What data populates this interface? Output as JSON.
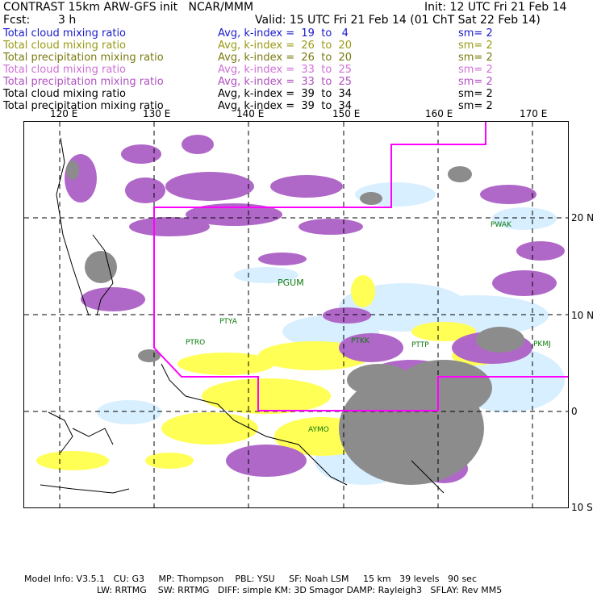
{
  "header": {
    "title": "CONTRAST 15km ARW-GFS init   NCAR/MMM",
    "init": "Init: 12 UTC Fri 21 Feb 14",
    "fcst_label": "Fcst:",
    "fcst_value": "3 h",
    "valid": "Valid: 15 UTC Fri 21 Feb 14 (01 ChT Sat 22 Feb 14)"
  },
  "legend_rows": [
    {
      "field": "Total cloud mixing ratio",
      "avg": "Avg, k-index =  19  to   4",
      "sm": "sm= 2",
      "color": "#1a1acd"
    },
    {
      "field": "Total cloud mixing ratio",
      "avg": "Avg, k-index =  26  to  20",
      "sm": "sm= 2",
      "color": "#9a9a14"
    },
    {
      "field": "Total precipitation mixing ratio",
      "avg": "Avg, k-index =  26  to  20",
      "sm": "sm= 2",
      "color": "#7a7a10"
    },
    {
      "field": "Total cloud mixing ratio",
      "avg": "Avg, k-index =  33  to  25",
      "sm": "sm= 2",
      "color": "#d070d8"
    },
    {
      "field": "Total precipitation mixing ratio",
      "avg": "Avg, k-index =  33  to  25",
      "sm": "sm= 2",
      "color": "#b050c0"
    },
    {
      "field": "Total cloud mixing ratio",
      "avg": "Avg, k-index =  39  to  34",
      "sm": "sm= 2",
      "color": "#000000"
    },
    {
      "field": "Total precipitation mixing ratio",
      "avg": "Avg, k-index =  39  to  34",
      "sm": "sm= 2",
      "color": "#000000"
    }
  ],
  "map": {
    "lon_labels": [
      "120 E",
      "130 E",
      "140 E",
      "150 E",
      "160 E",
      "170 E"
    ],
    "lat_labels": [
      "20 N",
      "10 N",
      "0",
      "10 S"
    ],
    "stations": [
      "PGUM",
      "PTYA",
      "PTRO",
      "PTKK",
      "PTTP",
      "PKMJ",
      "PWAK",
      "AYMO"
    ],
    "colors": {
      "cloud_light": "#d8efff",
      "precip_yellow": "#ffff55",
      "purple": "#b068c8",
      "gray": "#8c8c8c",
      "box": "#ff00ff"
    }
  },
  "footer": {
    "line1": "Model Info: V3.5.1   CU: G3     MP: Thompson    PBL: YSU     SF: Noah LSM     15 km   39 levels   90 sec",
    "line2": "LW: RRTMG    SW: RRTMG   DIFF: simple KM: 3D Smagor DAMP: Rayleigh3   SFLAY: Rev MM5"
  }
}
